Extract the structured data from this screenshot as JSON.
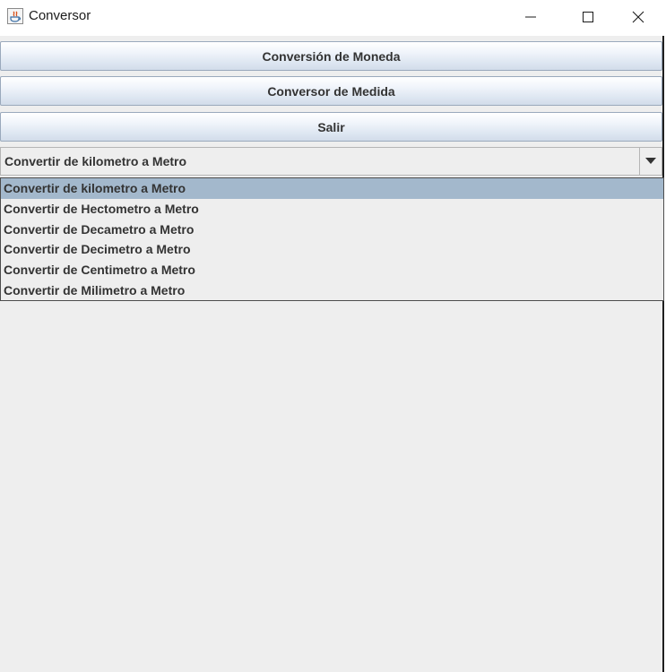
{
  "window": {
    "title": "Conversor"
  },
  "buttons": {
    "moneda": "Conversión de Moneda",
    "medida": "Conversor de Medida",
    "salir": "Salir"
  },
  "combo": {
    "selected": "Convertir de kilometro a Metro",
    "options": [
      "Convertir de kilometro a Metro",
      "Convertir de Hectometro a Metro",
      "Convertir de Decametro a Metro",
      "Convertir de Decimetro a Metro",
      "Convertir de Centimetro a Metro",
      "Convertir de Milimetro a Metro"
    ]
  },
  "icons": {
    "app": "java-app-icon",
    "minimize": "minimize-icon",
    "maximize": "maximize-icon",
    "close": "close-icon",
    "dropdown": "chevron-down-icon"
  },
  "colors": {
    "selection": "#a3b8cc",
    "button_border": "#9aa9bc",
    "window_bg": "#eeeeee"
  }
}
